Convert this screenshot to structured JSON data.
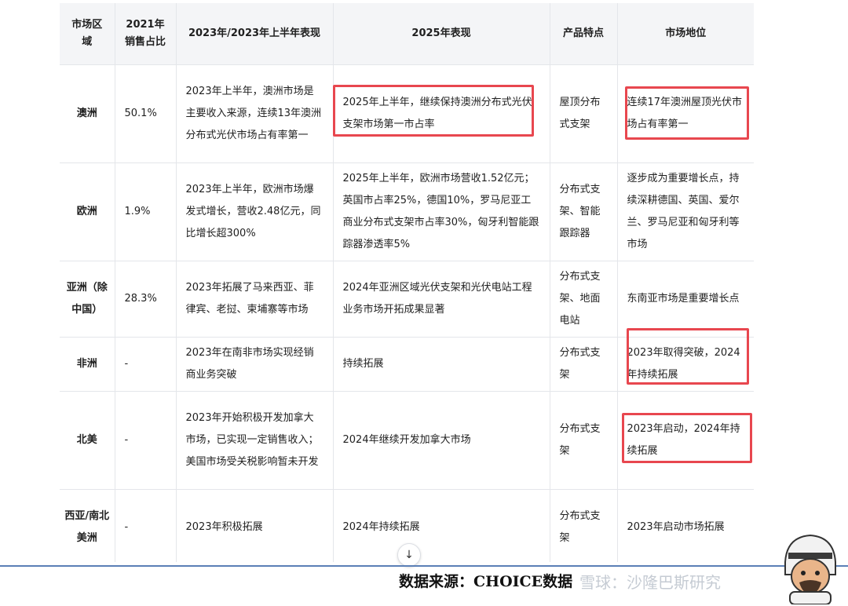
{
  "headers": [
    "市场区域",
    "2021年销售占比",
    "2023年/2023年上半年表现",
    "2025年表现",
    "产品特点",
    "市场地位"
  ],
  "rows": [
    {
      "region": "澳洲",
      "share": "50.1%",
      "perf2023": "2023年上半年，澳洲市场是主要收入来源，连续13年澳洲分布式光伏市场占有率第一",
      "perf2025": "2025年上半年，继续保持澳洲分布式光伏支架市场第一市占率",
      "product": "屋顶分布式支架",
      "position": "连续17年澳洲屋顶光伏市场占有率第一"
    },
    {
      "region": "欧洲",
      "share": "1.9%",
      "perf2023": "2023年上半年，欧洲市场爆发式增长，营收2.48亿元，同比增长超300%",
      "perf2025": "2025年上半年，欧洲市场营收1.52亿元；英国市占率25%，德国10%，罗马尼亚工商业分布式支架市占率30%，匈牙利智能跟踪器渗透率5%",
      "product": "分布式支架、智能跟踪器",
      "position": "逐步成为重要增长点，持续深耕德国、英国、爱尔兰、罗马尼亚和匈牙利等市场"
    },
    {
      "region": "亚洲（除中国）",
      "share": "28.3%",
      "perf2023": "2023年拓展了马来西亚、菲律宾、老挝、柬埔寨等市场",
      "perf2025": "2024年亚洲区域光伏支架和光伏电站工程业务市场开拓成果显著",
      "product": "分布式支架、地面电站",
      "position": "东南亚市场是重要增长点"
    },
    {
      "region": "非洲",
      "share": "-",
      "perf2023": "2023年在南非市场实现经销商业务突破",
      "perf2025": "持续拓展",
      "product": "分布式支架",
      "position": "2023年取得突破，2024年持续拓展"
    },
    {
      "region": "北美",
      "share": "-",
      "perf2023": "2023年开始积极开发加拿大市场，已实现一定销售收入；美国市场受关税影响暂未开发",
      "perf2025": "2024年继续开发加拿大市场",
      "product": "分布式支架",
      "position": "2023年启动，2024年持续拓展"
    },
    {
      "region": "西亚/南北美洲",
      "share": "-",
      "perf2023": "2023年积极拓展",
      "perf2025": "2024年持续拓展",
      "product": "分布式支架",
      "position": "2023年启动市场拓展"
    }
  ],
  "footer": {
    "source": "数据来源：CHOICE数据",
    "watermark": "雪球：沙隆巴斯研究",
    "scroll_icon": "↓"
  },
  "highlight_color": "#e8474f"
}
